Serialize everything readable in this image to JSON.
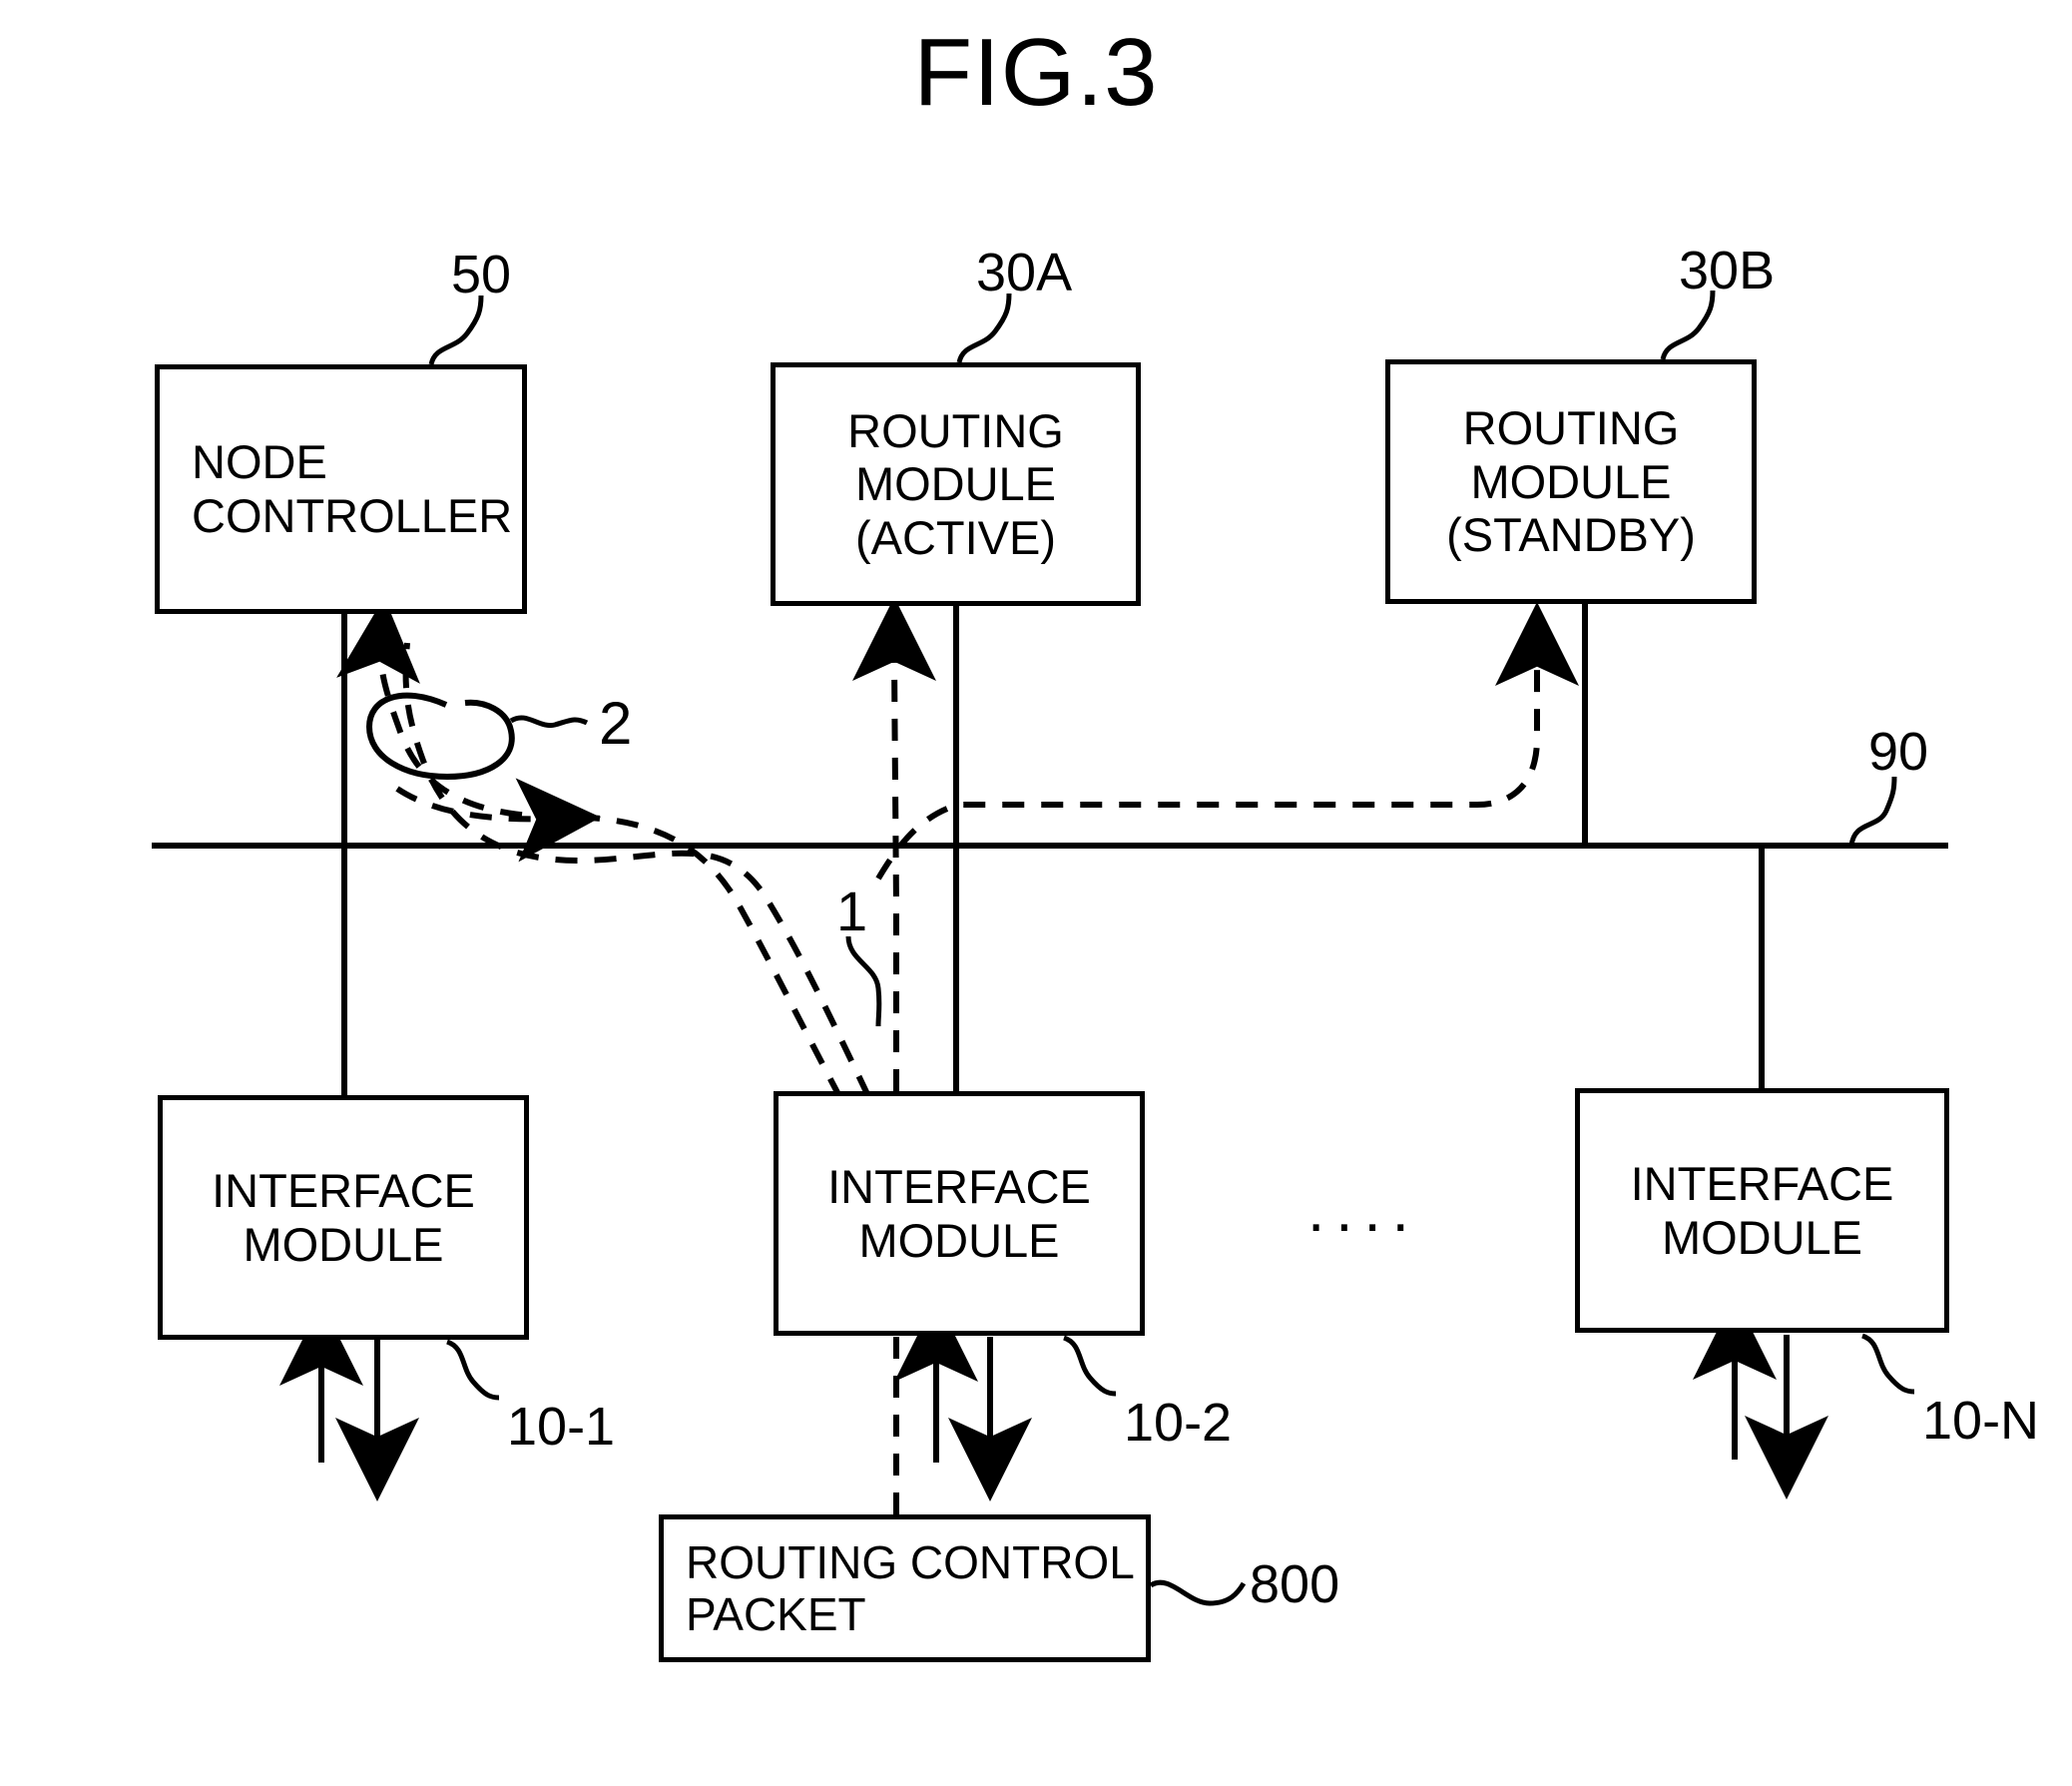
{
  "figure": {
    "title": "FIG.3"
  },
  "boxes": {
    "node_controller": {
      "label": "NODE\nCONTROLLER",
      "ref": "50"
    },
    "routing_module_active": {
      "label": "ROUTING\nMODULE\n(ACTIVE)",
      "ref": "30A"
    },
    "routing_module_standby": {
      "label": "ROUTING\nMODULE\n(STANDBY)",
      "ref": "30B"
    },
    "interface_module_1": {
      "label": "INTERFACE\nMODULE",
      "ref": "10-1"
    },
    "interface_module_2": {
      "label": "INTERFACE\nMODULE",
      "ref": "10-2"
    },
    "interface_module_n": {
      "label": "INTERFACE\nMODULE",
      "ref": "10-N"
    },
    "routing_control_packet": {
      "label": "ROUTING CONTROL\nPACKET",
      "ref": "800"
    }
  },
  "annotations": {
    "bus_ref": "90",
    "flow_1_ref": "1",
    "flow_2_ref": "2",
    "ellipsis": "...."
  },
  "colors": {
    "stroke": "#000000",
    "background": "#ffffff"
  }
}
